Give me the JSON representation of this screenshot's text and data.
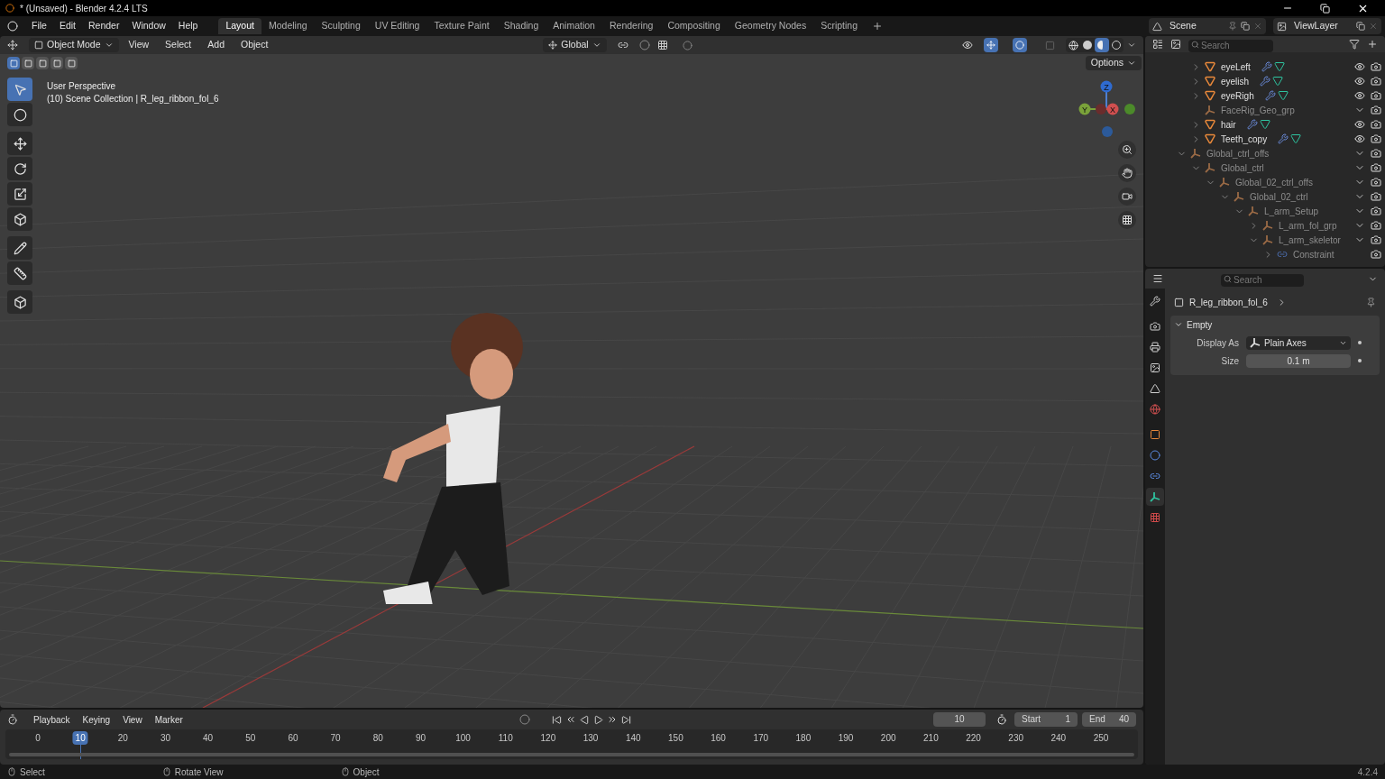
{
  "window": {
    "title": "* (Unsaved) - Blender 4.2.4 LTS"
  },
  "menu": [
    "File",
    "Edit",
    "Render",
    "Window",
    "Help"
  ],
  "workspaces": [
    {
      "label": "Layout",
      "selected": true
    },
    {
      "label": "Modeling",
      "selected": false
    },
    {
      "label": "Sculpting",
      "selected": false
    },
    {
      "label": "UV Editing",
      "selected": false
    },
    {
      "label": "Texture Paint",
      "selected": false
    },
    {
      "label": "Shading",
      "selected": false
    },
    {
      "label": "Animation",
      "selected": false
    },
    {
      "label": "Rendering",
      "selected": false
    },
    {
      "label": "Compositing",
      "selected": false
    },
    {
      "label": "Geometry Nodes",
      "selected": false
    },
    {
      "label": "Scripting",
      "selected": false
    }
  ],
  "scene_selector": {
    "value": "Scene"
  },
  "view_layer_selector": {
    "value": "ViewLayer"
  },
  "viewport_header": {
    "mode": "Object Mode",
    "menus": [
      "View",
      "Select",
      "Add",
      "Object"
    ],
    "orientation": "Global",
    "options": "Options",
    "shading": [
      {
        "kind": "wireframe",
        "selected": false
      },
      {
        "kind": "solid",
        "selected": false
      },
      {
        "kind": "material",
        "selected": true
      },
      {
        "kind": "rendered",
        "selected": false
      }
    ],
    "selection_modes": [
      {
        "selected": true
      },
      {
        "selected": false
      },
      {
        "selected": false
      },
      {
        "selected": false
      },
      {
        "selected": false
      }
    ]
  },
  "viewport": {
    "title": "User Perspective",
    "subtitle": "(10) Scene Collection | R_leg_ribbon_fol_6",
    "gizmo_axes": [
      "Z",
      "Y",
      "X"
    ]
  },
  "tools": [
    {
      "kind": "select-box",
      "selected": true
    },
    {
      "kind": "cursor",
      "selected": false
    },
    {
      "kind": "move",
      "selected": false
    },
    {
      "kind": "rotate",
      "selected": false
    },
    {
      "kind": "scale",
      "selected": false
    },
    {
      "kind": "transform",
      "selected": false
    },
    {
      "kind": "annotate",
      "selected": false
    },
    {
      "kind": "measure",
      "selected": false
    },
    {
      "kind": "add-cube",
      "selected": false
    }
  ],
  "outliner": {
    "search": {
      "placeholder": "Search"
    },
    "clipped_children": [
      {
        "name": "eyeLeft",
        "kind": "mesh",
        "expanded": false,
        "visible": true
      },
      {
        "name": "eyelish",
        "kind": "mesh",
        "expanded": false,
        "visible": true
      },
      {
        "name": "eyeRigh",
        "kind": "mesh",
        "expanded": false,
        "visible": true
      },
      {
        "name": "FaceRig_Geo_grp",
        "kind": "empty",
        "visible": false
      },
      {
        "name": "hair",
        "kind": "mesh",
        "expanded": false,
        "visible": true
      },
      {
        "name": "Teeth_copy",
        "kind": "mesh",
        "expanded": false,
        "visible": true
      }
    ],
    "items": [
      {
        "name": "Global_ctrl_offs",
        "kind": "empty",
        "expanded": true,
        "visible": false,
        "children": [
          {
            "name": "Global_ctrl",
            "kind": "empty",
            "expanded": true,
            "visible": false,
            "children": [
              {
                "name": "Global_02_ctrl_offs",
                "kind": "empty",
                "expanded": true,
                "visible": false,
                "children": [
                  {
                    "name": "Global_02_ctrl",
                    "kind": "empty",
                    "expanded": true,
                    "visible": false,
                    "children": [
                      {
                        "name": "L_arm_Setup",
                        "kind": "empty",
                        "expanded": true,
                        "visible": false,
                        "children": [
                          {
                            "name": "L_arm_fol_grp",
                            "kind": "empty",
                            "expanded": false,
                            "visible": false
                          },
                          {
                            "name": "L_arm_skeletor",
                            "kind": "empty",
                            "expanded": true,
                            "visible": false,
                            "children": [
                              {
                                "name": "Constraint",
                                "kind": "constraint",
                                "expanded": false
                              }
                            ]
                          }
                        ]
                      }
                    ]
                  }
                ]
              }
            ]
          }
        ]
      }
    ]
  },
  "properties": {
    "search": {
      "placeholder": "Search"
    },
    "tabs": [
      {
        "kind": "tool",
        "selected": false
      },
      {
        "kind": "render",
        "selected": false
      },
      {
        "kind": "output",
        "selected": false
      },
      {
        "kind": "view-layer",
        "selected": false
      },
      {
        "kind": "scene",
        "selected": false
      },
      {
        "kind": "world",
        "selected": false
      },
      {
        "kind": "object",
        "selected": false
      },
      {
        "kind": "physics",
        "selected": false
      },
      {
        "kind": "constraints",
        "selected": false
      },
      {
        "kind": "data",
        "selected": true
      },
      {
        "kind": "texture",
        "selected": false
      }
    ],
    "object_name": "R_leg_ribbon_fol_6",
    "panel": {
      "title": "Empty",
      "expanded": true,
      "fields": [
        {
          "label": "Display As",
          "kind": "dropdown",
          "value": "Plain Axes"
        },
        {
          "label": "Size",
          "kind": "number",
          "value": "0.1 m"
        }
      ]
    }
  },
  "timeline": {
    "menus": [
      "Playback",
      "Keying",
      "View",
      "Marker"
    ],
    "current_frame": "10",
    "start_label": "Start",
    "start": "1",
    "end_label": "End",
    "end": "40",
    "frames": [
      {
        "label": "0",
        "selected": false
      },
      {
        "label": "10",
        "selected": true
      },
      {
        "label": "20",
        "selected": false
      },
      {
        "label": "30",
        "selected": false
      },
      {
        "label": "40",
        "selected": false
      },
      {
        "label": "50",
        "selected": false
      },
      {
        "label": "60",
        "selected": false
      },
      {
        "label": "70",
        "selected": false
      },
      {
        "label": "80",
        "selected": false
      },
      {
        "label": "90",
        "selected": false
      },
      {
        "label": "100",
        "selected": false
      },
      {
        "label": "110",
        "selected": false
      },
      {
        "label": "120",
        "selected": false
      },
      {
        "label": "130",
        "selected": false
      },
      {
        "label": "140",
        "selected": false
      },
      {
        "label": "150",
        "selected": false
      },
      {
        "label": "160",
        "selected": false
      },
      {
        "label": "170",
        "selected": false
      },
      {
        "label": "180",
        "selected": false
      },
      {
        "label": "190",
        "selected": false
      },
      {
        "label": "200",
        "selected": false
      },
      {
        "label": "210",
        "selected": false
      },
      {
        "label": "220",
        "selected": false
      },
      {
        "label": "230",
        "selected": false
      },
      {
        "label": "240",
        "selected": false
      },
      {
        "label": "250",
        "selected": false
      }
    ]
  },
  "status_bar": {
    "hints": [
      "Select",
      "Rotate View",
      "Object"
    ],
    "version": "4.2.4"
  }
}
